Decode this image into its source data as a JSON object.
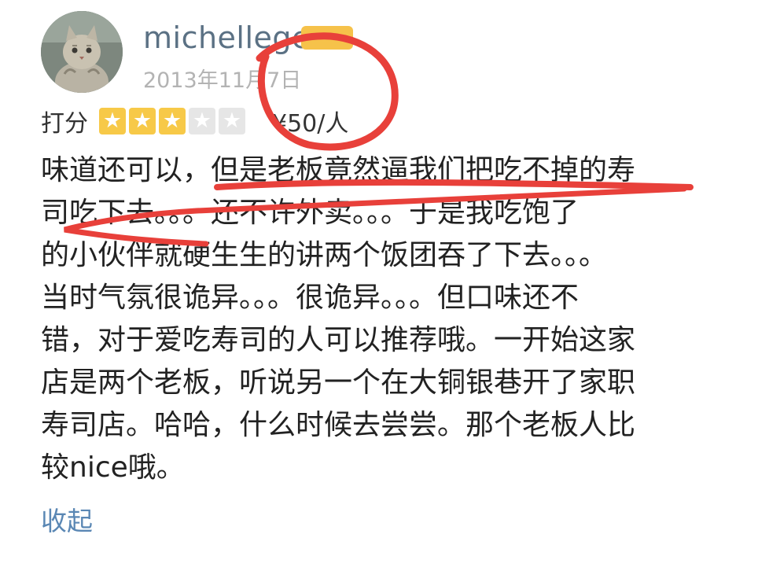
{
  "review": {
    "username": "michellege",
    "level_badge": "",
    "date": "2013年11月7日",
    "rating_label": "打分",
    "stars": [
      {
        "filled": true
      },
      {
        "filled": true
      },
      {
        "filled": true
      },
      {
        "filled": false
      },
      {
        "filled": false
      }
    ],
    "star_glyph": "★",
    "price": "¥50/人",
    "lines": [
      "味道还可以，但是老板竟然逼我们把吃不掉的寿",
      "司吃下去。。。还不许外卖。。。于是我吃饱了",
      "的小伙伴就硬生生的讲两个饭团吞了下去。。。",
      "当时气氛很诡异。。。很诡异。。。但口味还不",
      "错，对于爱吃寿司的人可以推荐哦。一开始这家",
      "店是两个老板，听说另一个在大铜银巷开了家职",
      "寿司店。哈哈，什么时候去尝尝。那个老板人比",
      "较nice哦。"
    ],
    "collapse_label": "收起"
  },
  "colors": {
    "username": "#5b7184",
    "badge": "#f6c24a",
    "star_on": "#f7c948",
    "star_off": "#e6e6e6",
    "link": "#5a87b4",
    "annotation_red": "#e8403a"
  },
  "icons": {
    "avatar": "cat-photo-avatar",
    "star": "star-icon"
  }
}
